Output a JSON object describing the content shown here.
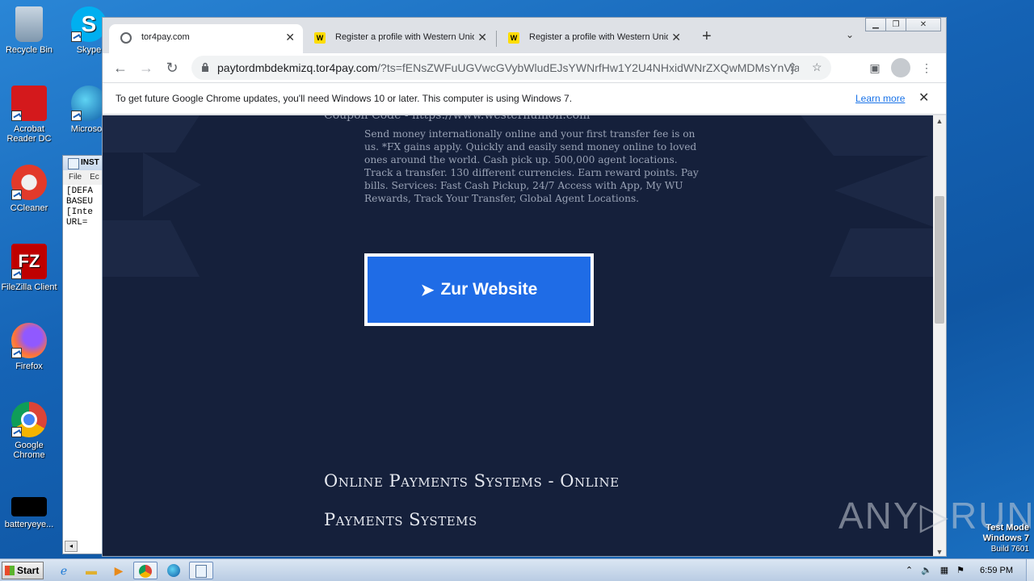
{
  "desktop": {
    "icons": [
      {
        "label": "Recycle Bin",
        "icon": "recycle-bin-icon"
      },
      {
        "label": "Skype",
        "icon": "skype-icon"
      },
      {
        "label": "Acrobat Reader DC",
        "icon": "acrobat-icon"
      },
      {
        "label": "Microsoft",
        "icon": "edge-icon"
      },
      {
        "label": "CCleaner",
        "icon": "ccleaner-icon"
      },
      {
        "label": "FileZilla Client",
        "icon": "filezilla-icon"
      },
      {
        "label": "Firefox",
        "icon": "firefox-icon"
      },
      {
        "label": "Google Chrome",
        "icon": "chrome-icon"
      },
      {
        "label": "batteryeye...",
        "icon": "battery-icon"
      }
    ]
  },
  "notepad": {
    "title": "INST",
    "menu": [
      "File",
      "Ec"
    ],
    "lines": [
      "[DEFA",
      "BASEU",
      "[Inte",
      "URL="
    ]
  },
  "browser": {
    "tabs": [
      {
        "title": "tor4pay.com",
        "icon": "globe-icon",
        "active": true
      },
      {
        "title": "Register a profile with Western Unio",
        "icon": "western-union-icon",
        "active": false
      },
      {
        "title": "Register a profile with Western Unio",
        "icon": "western-union-icon",
        "active": false
      }
    ],
    "tab_logo_text": "W",
    "new_tab": "+",
    "tab_search": "⌄",
    "url_host": "paytordmbdekmizq.tor4pay.com",
    "url_rest": "/?ts=fENsZWFuUGVwcGVybWludEJsYWNrfHw1Y2U4NHxidWNrZXQwMDMsYnVja2...",
    "infobar": {
      "message": "To get future Google Chrome updates, you'll need Windows 10 or later. This computer is using Windows 7.",
      "link": "Learn more"
    }
  },
  "page": {
    "cut_text": "Coupon Code - https://www.westernunion.com",
    "description": "Send money internationally online and your first transfer fee is on us. *FX gains apply. Quickly and easily send money online to loved ones around the world. Cash pick up. 500,000 agent locations. Track a transfer. 130 different currencies. Earn reward points. Pay bills. Services: Fast Cash Pickup, 24/7 Access with App, My WU Rewards, Track Your Transfer, Global Agent Locations.",
    "cta_arrow": "➤",
    "cta_label": "Zur Website",
    "heading_line1": "Online Payments Systems - Online",
    "heading_line2": "Payments Systems"
  },
  "watermark": "ANY▷RUN",
  "testmode": {
    "line1": "Test Mode",
    "line2": "Windows 7",
    "line3": "Build 7601"
  },
  "taskbar": {
    "start_label": "Start",
    "clock": "6:59 PM"
  },
  "colors": {
    "cta": "#1f6ce6",
    "page_bg": "#15203b",
    "link": "#1a73e8"
  }
}
